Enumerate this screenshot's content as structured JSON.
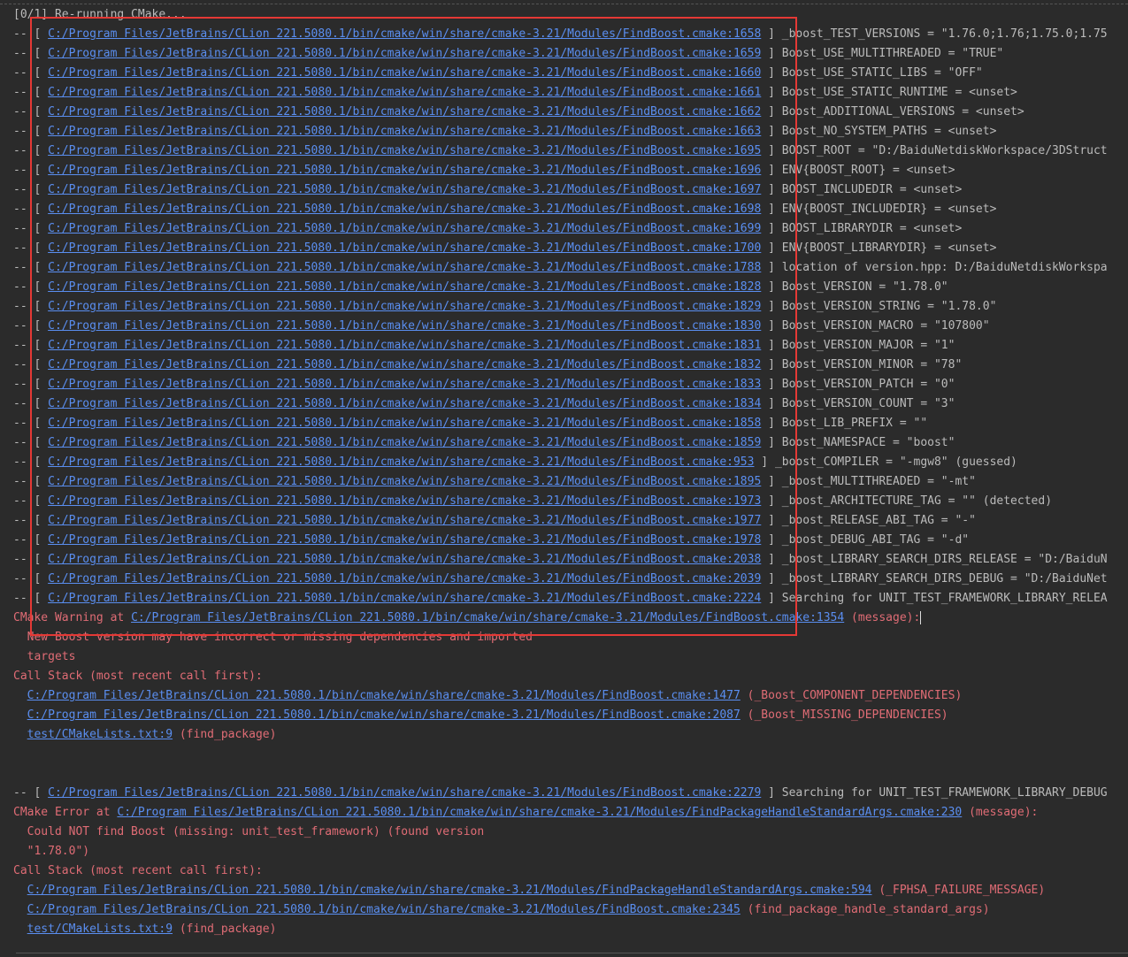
{
  "header_line": "[0/1] Re-running CMake...",
  "debug_prefix": "-- [ ",
  "debug_suffix": " ] ",
  "debug_rows": [
    {
      "link": "C:/Program Files/JetBrains/CLion 221.5080.1/bin/cmake/win/share/cmake-3.21/Modules/FindBoost.cmake:1658",
      "text": "_boost_TEST_VERSIONS = \"1.76.0;1.76;1.75.0;1.75"
    },
    {
      "link": "C:/Program Files/JetBrains/CLion 221.5080.1/bin/cmake/win/share/cmake-3.21/Modules/FindBoost.cmake:1659",
      "text": "Boost_USE_MULTITHREADED = \"TRUE\""
    },
    {
      "link": "C:/Program Files/JetBrains/CLion 221.5080.1/bin/cmake/win/share/cmake-3.21/Modules/FindBoost.cmake:1660",
      "text": "Boost_USE_STATIC_LIBS = \"OFF\""
    },
    {
      "link": "C:/Program Files/JetBrains/CLion 221.5080.1/bin/cmake/win/share/cmake-3.21/Modules/FindBoost.cmake:1661",
      "text": "Boost_USE_STATIC_RUNTIME = <unset>"
    },
    {
      "link": "C:/Program Files/JetBrains/CLion 221.5080.1/bin/cmake/win/share/cmake-3.21/Modules/FindBoost.cmake:1662",
      "text": "Boost_ADDITIONAL_VERSIONS = <unset>"
    },
    {
      "link": "C:/Program Files/JetBrains/CLion 221.5080.1/bin/cmake/win/share/cmake-3.21/Modules/FindBoost.cmake:1663",
      "text": "Boost_NO_SYSTEM_PATHS = <unset>"
    },
    {
      "link": "C:/Program Files/JetBrains/CLion 221.5080.1/bin/cmake/win/share/cmake-3.21/Modules/FindBoost.cmake:1695",
      "text": "BOOST_ROOT = \"D:/BaiduNetdiskWorkspace/3DStruct"
    },
    {
      "link": "C:/Program Files/JetBrains/CLion 221.5080.1/bin/cmake/win/share/cmake-3.21/Modules/FindBoost.cmake:1696",
      "text": "ENV{BOOST_ROOT} = <unset>"
    },
    {
      "link": "C:/Program Files/JetBrains/CLion 221.5080.1/bin/cmake/win/share/cmake-3.21/Modules/FindBoost.cmake:1697",
      "text": "BOOST_INCLUDEDIR = <unset>"
    },
    {
      "link": "C:/Program Files/JetBrains/CLion 221.5080.1/bin/cmake/win/share/cmake-3.21/Modules/FindBoost.cmake:1698",
      "text": "ENV{BOOST_INCLUDEDIR} = <unset>"
    },
    {
      "link": "C:/Program Files/JetBrains/CLion 221.5080.1/bin/cmake/win/share/cmake-3.21/Modules/FindBoost.cmake:1699",
      "text": "BOOST_LIBRARYDIR = <unset>"
    },
    {
      "link": "C:/Program Files/JetBrains/CLion 221.5080.1/bin/cmake/win/share/cmake-3.21/Modules/FindBoost.cmake:1700",
      "text": "ENV{BOOST_LIBRARYDIR} = <unset>"
    },
    {
      "link": "C:/Program Files/JetBrains/CLion 221.5080.1/bin/cmake/win/share/cmake-3.21/Modules/FindBoost.cmake:1788",
      "text": "location of version.hpp: D:/BaiduNetdiskWorkspa"
    },
    {
      "link": "C:/Program Files/JetBrains/CLion 221.5080.1/bin/cmake/win/share/cmake-3.21/Modules/FindBoost.cmake:1828",
      "text": "Boost_VERSION = \"1.78.0\""
    },
    {
      "link": "C:/Program Files/JetBrains/CLion 221.5080.1/bin/cmake/win/share/cmake-3.21/Modules/FindBoost.cmake:1829",
      "text": "Boost_VERSION_STRING = \"1.78.0\""
    },
    {
      "link": "C:/Program Files/JetBrains/CLion 221.5080.1/bin/cmake/win/share/cmake-3.21/Modules/FindBoost.cmake:1830",
      "text": "Boost_VERSION_MACRO = \"107800\""
    },
    {
      "link": "C:/Program Files/JetBrains/CLion 221.5080.1/bin/cmake/win/share/cmake-3.21/Modules/FindBoost.cmake:1831",
      "text": "Boost_VERSION_MAJOR = \"1\""
    },
    {
      "link": "C:/Program Files/JetBrains/CLion 221.5080.1/bin/cmake/win/share/cmake-3.21/Modules/FindBoost.cmake:1832",
      "text": "Boost_VERSION_MINOR = \"78\""
    },
    {
      "link": "C:/Program Files/JetBrains/CLion 221.5080.1/bin/cmake/win/share/cmake-3.21/Modules/FindBoost.cmake:1833",
      "text": "Boost_VERSION_PATCH = \"0\""
    },
    {
      "link": "C:/Program Files/JetBrains/CLion 221.5080.1/bin/cmake/win/share/cmake-3.21/Modules/FindBoost.cmake:1834",
      "text": "Boost_VERSION_COUNT = \"3\""
    },
    {
      "link": "C:/Program Files/JetBrains/CLion 221.5080.1/bin/cmake/win/share/cmake-3.21/Modules/FindBoost.cmake:1858",
      "text": "Boost_LIB_PREFIX = \"\""
    },
    {
      "link": "C:/Program Files/JetBrains/CLion 221.5080.1/bin/cmake/win/share/cmake-3.21/Modules/FindBoost.cmake:1859",
      "text": "Boost_NAMESPACE = \"boost\""
    },
    {
      "link": "C:/Program Files/JetBrains/CLion 221.5080.1/bin/cmake/win/share/cmake-3.21/Modules/FindBoost.cmake:953",
      "text": "_boost_COMPILER = \"-mgw8\" (guessed)"
    },
    {
      "link": "C:/Program Files/JetBrains/CLion 221.5080.1/bin/cmake/win/share/cmake-3.21/Modules/FindBoost.cmake:1895",
      "text": "_boost_MULTITHREADED = \"-mt\""
    },
    {
      "link": "C:/Program Files/JetBrains/CLion 221.5080.1/bin/cmake/win/share/cmake-3.21/Modules/FindBoost.cmake:1973",
      "text": "_boost_ARCHITECTURE_TAG = \"\" (detected)"
    },
    {
      "link": "C:/Program Files/JetBrains/CLion 221.5080.1/bin/cmake/win/share/cmake-3.21/Modules/FindBoost.cmake:1977",
      "text": "_boost_RELEASE_ABI_TAG = \"-\""
    },
    {
      "link": "C:/Program Files/JetBrains/CLion 221.5080.1/bin/cmake/win/share/cmake-3.21/Modules/FindBoost.cmake:1978",
      "text": "_boost_DEBUG_ABI_TAG = \"-d\""
    },
    {
      "link": "C:/Program Files/JetBrains/CLion 221.5080.1/bin/cmake/win/share/cmake-3.21/Modules/FindBoost.cmake:2038",
      "text": "_boost_LIBRARY_SEARCH_DIRS_RELEASE = \"D:/BaiduN"
    },
    {
      "link": "C:/Program Files/JetBrains/CLion 221.5080.1/bin/cmake/win/share/cmake-3.21/Modules/FindBoost.cmake:2039",
      "text": "_boost_LIBRARY_SEARCH_DIRS_DEBUG = \"D:/BaiduNet"
    },
    {
      "link": "C:/Program Files/JetBrains/CLion 221.5080.1/bin/cmake/win/share/cmake-3.21/Modules/FindBoost.cmake:2224",
      "text": "Searching for UNIT_TEST_FRAMEWORK_LIBRARY_RELEA"
    }
  ],
  "warning": {
    "prefix": "CMake Warning at ",
    "link": "C:/Program Files/JetBrains/CLion 221.5080.1/bin/cmake/win/share/cmake-3.21/Modules/FindBoost.cmake:1354",
    "suffix": " (message):",
    "message_line1": "  New Boost version may have incorrect or missing dependencies and imported",
    "message_line2": "  targets",
    "callstack_header": "Call Stack (most recent call first):",
    "calls": [
      {
        "link": "C:/Program Files/JetBrains/CLion 221.5080.1/bin/cmake/win/share/cmake-3.21/Modules/FindBoost.cmake:1477",
        "func": " (_Boost_COMPONENT_DEPENDENCIES)"
      },
      {
        "link": "C:/Program Files/JetBrains/CLion 221.5080.1/bin/cmake/win/share/cmake-3.21/Modules/FindBoost.cmake:2087",
        "func": " (_Boost_MISSING_DEPENDENCIES)"
      },
      {
        "link": "test/CMakeLists.txt:9",
        "func": " (find_package)"
      }
    ]
  },
  "debug_row_after": {
    "link": "C:/Program Files/JetBrains/CLion 221.5080.1/bin/cmake/win/share/cmake-3.21/Modules/FindBoost.cmake:2279",
    "text": "Searching for UNIT_TEST_FRAMEWORK_LIBRARY_DEBUG"
  },
  "error": {
    "prefix": "CMake Error at ",
    "link": "C:/Program Files/JetBrains/CLion 221.5080.1/bin/cmake/win/share/cmake-3.21/Modules/FindPackageHandleStandardArgs.cmake:230",
    "suffix": " (message):",
    "message_line1": "  Could NOT find Boost (missing: unit_test_framework) (found version",
    "message_line2": "  \"1.78.0\")",
    "callstack_header": "Call Stack (most recent call first):",
    "calls": [
      {
        "link": "C:/Program Files/JetBrains/CLion 221.5080.1/bin/cmake/win/share/cmake-3.21/Modules/FindPackageHandleStandardArgs.cmake:594",
        "func": " (_FPHSA_FAILURE_MESSAGE)"
      },
      {
        "link": "C:/Program Files/JetBrains/CLion 221.5080.1/bin/cmake/win/share/cmake-3.21/Modules/FindBoost.cmake:2345",
        "func": " (find_package_handle_standard_args)"
      },
      {
        "link": "test/CMakeLists.txt:9",
        "func": " (find_package)"
      }
    ]
  },
  "colors": {
    "background": "#2b2b2b",
    "text": "#bbbbbb",
    "link": "#5a8ef0",
    "error": "#e06c75",
    "highlight_box": "#e53935"
  }
}
